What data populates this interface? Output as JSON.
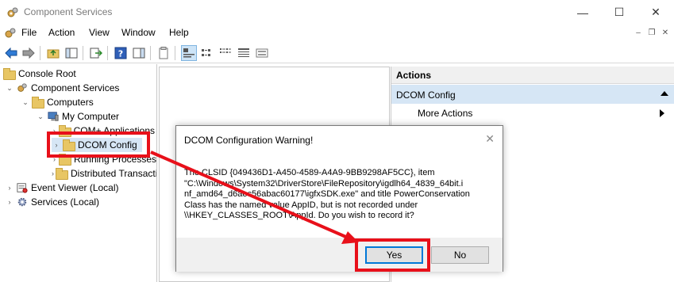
{
  "window": {
    "title": "Component Services",
    "controls": {
      "minimize": "—",
      "maximize": "☐",
      "close": "✕"
    }
  },
  "menubar": {
    "items": [
      "File",
      "Action",
      "View",
      "Window",
      "Help"
    ],
    "mdi_controls": {
      "minimize": "–",
      "restore": "❐",
      "close": "✕"
    }
  },
  "tree": {
    "items": [
      {
        "label": "Console Root"
      },
      {
        "label": "Component Services"
      },
      {
        "label": "Computers"
      },
      {
        "label": "My Computer"
      },
      {
        "label": "COM+ Applications"
      },
      {
        "label": "DCOM Config"
      },
      {
        "label": "Running Processes"
      },
      {
        "label": "Distributed Transaction Coordinator"
      },
      {
        "label": "Event Viewer (Local)"
      },
      {
        "label": "Services (Local)"
      }
    ]
  },
  "actions": {
    "header": "Actions",
    "section": "DCOM Config",
    "more": "More Actions"
  },
  "dialog": {
    "title": "DCOM Configuration Warning!",
    "message": "The CLSID {049436D1-A450-4589-A4A9-9BB9298AF5CC}, item\n\"C:\\Windows\\System32\\DriverStore\\FileRepository\\igdlh64_4839_64bit.i\nnf_amd64_d6aec56abac60177\\igfxSDK.exe\" and title PowerConservation\nClass has the named value AppID, but is not recorded under\n\\\\HKEY_CLASSES_ROOT\\AppId.  Do you wish to record it?",
    "yes_label": "Yes",
    "no_label": "No",
    "close": "✕"
  },
  "colors": {
    "annotation_red": "#e8101a",
    "selection_blue": "#d6e6f5",
    "folder_yellow": "#e8c664"
  }
}
